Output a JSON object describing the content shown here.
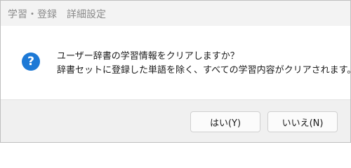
{
  "window": {
    "title": "学習・登録　詳細設定"
  },
  "dialog": {
    "icon": "question-icon",
    "icon_glyph": "?",
    "icon_color": "#1d79d6",
    "message_line1": "ユーザー辞書の学習情報をクリアしますか？",
    "message_line2": "辞書セットに登録した単語を除く、すべての学習内容がクリアされます。"
  },
  "buttons": {
    "yes_label": "はい(Y)",
    "no_label": "いいえ(N)"
  }
}
